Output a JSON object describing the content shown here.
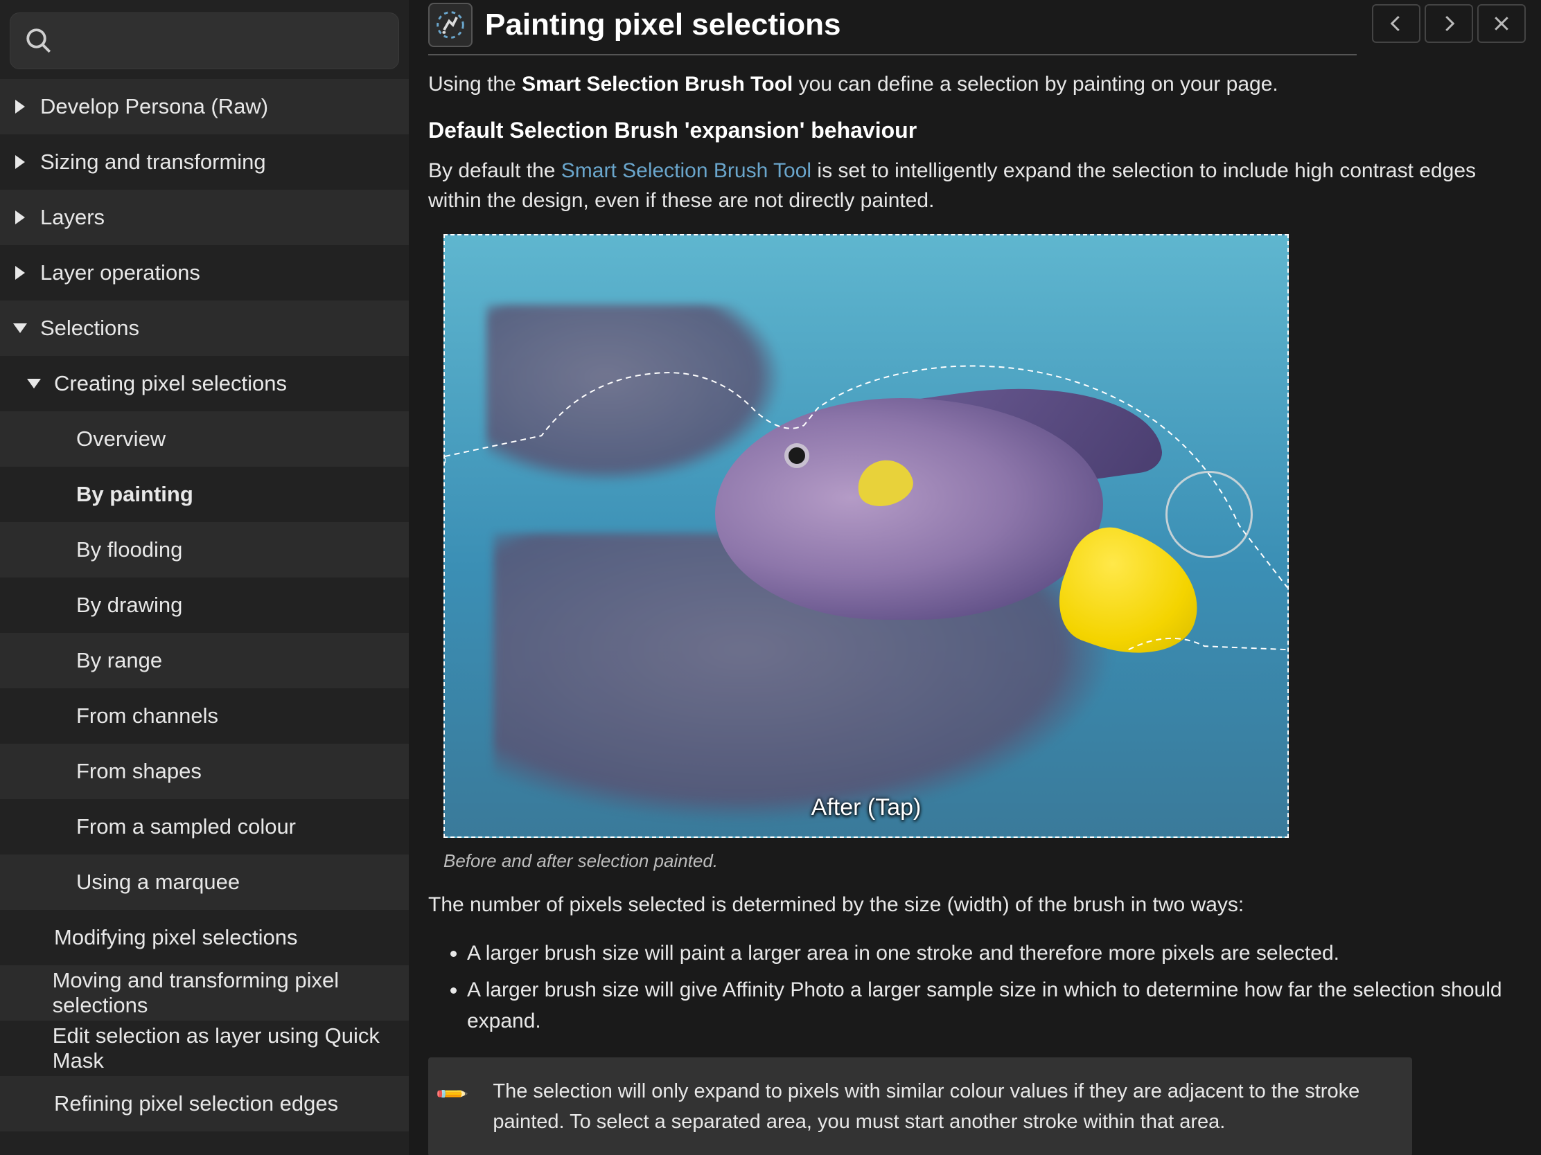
{
  "search": {
    "placeholder": ""
  },
  "sidebar": [
    {
      "label": "Develop Persona (Raw)",
      "depth": 0,
      "arrow": "right",
      "alt": true
    },
    {
      "label": "Sizing and transforming",
      "depth": 0,
      "arrow": "right",
      "alt": false
    },
    {
      "label": "Layers",
      "depth": 0,
      "arrow": "right",
      "alt": true
    },
    {
      "label": "Layer operations",
      "depth": 0,
      "arrow": "right",
      "alt": false
    },
    {
      "label": "Selections",
      "depth": 0,
      "arrow": "down",
      "alt": true
    },
    {
      "label": "Creating pixel selections",
      "depth": 1,
      "arrow": "down",
      "alt": false
    },
    {
      "label": "Overview",
      "depth": 2,
      "arrow": "",
      "alt": true
    },
    {
      "label": "By painting",
      "depth": 2,
      "arrow": "",
      "alt": false,
      "active": true
    },
    {
      "label": "By flooding",
      "depth": 2,
      "arrow": "",
      "alt": true
    },
    {
      "label": "By drawing",
      "depth": 2,
      "arrow": "",
      "alt": false
    },
    {
      "label": "By range",
      "depth": 2,
      "arrow": "",
      "alt": true
    },
    {
      "label": "From channels",
      "depth": 2,
      "arrow": "",
      "alt": false
    },
    {
      "label": "From shapes",
      "depth": 2,
      "arrow": "",
      "alt": true
    },
    {
      "label": "From a sampled colour",
      "depth": 2,
      "arrow": "",
      "alt": false
    },
    {
      "label": "Using a marquee",
      "depth": 2,
      "arrow": "",
      "alt": true
    },
    {
      "label": "Modifying pixel selections",
      "depth": 1,
      "arrow": "",
      "alt": false
    },
    {
      "label": "Moving and transforming pixel selections",
      "depth": 1,
      "arrow": "",
      "alt": true
    },
    {
      "label": "Edit selection as layer using Quick Mask",
      "depth": 1,
      "arrow": "",
      "alt": false
    },
    {
      "label": "Refining pixel selection edges",
      "depth": 1,
      "arrow": "",
      "alt": true
    }
  ],
  "page": {
    "title": "Painting pixel selections",
    "intro_pre": "Using the ",
    "intro_tool": "Smart Selection Brush Tool",
    "intro_post": " you can define a selection by painting on your page.",
    "subhead": "Default Selection Brush 'expansion' behaviour",
    "p2_pre": "By default the ",
    "p2_link": "Smart Selection Brush Tool",
    "p2_post": " is set to intelligently expand the selection to include high contrast edges within the design, even if these are not directly painted.",
    "after_label": "After (Tap)",
    "caption": "Before and after selection painted.",
    "p3": "The number of pixels selected is determined by the size (width) of the brush in two ways:",
    "bullets": [
      "A larger brush size will paint a larger area in one stroke and therefore more pixels are selected.",
      "A larger brush size will give Affinity Photo a larger sample size in which to determine how far the selection should expand."
    ],
    "note": "The selection will only expand to pixels with similar colour values if they are adjacent to the stroke painted. To select a separated area, you must start another stroke within that area."
  }
}
